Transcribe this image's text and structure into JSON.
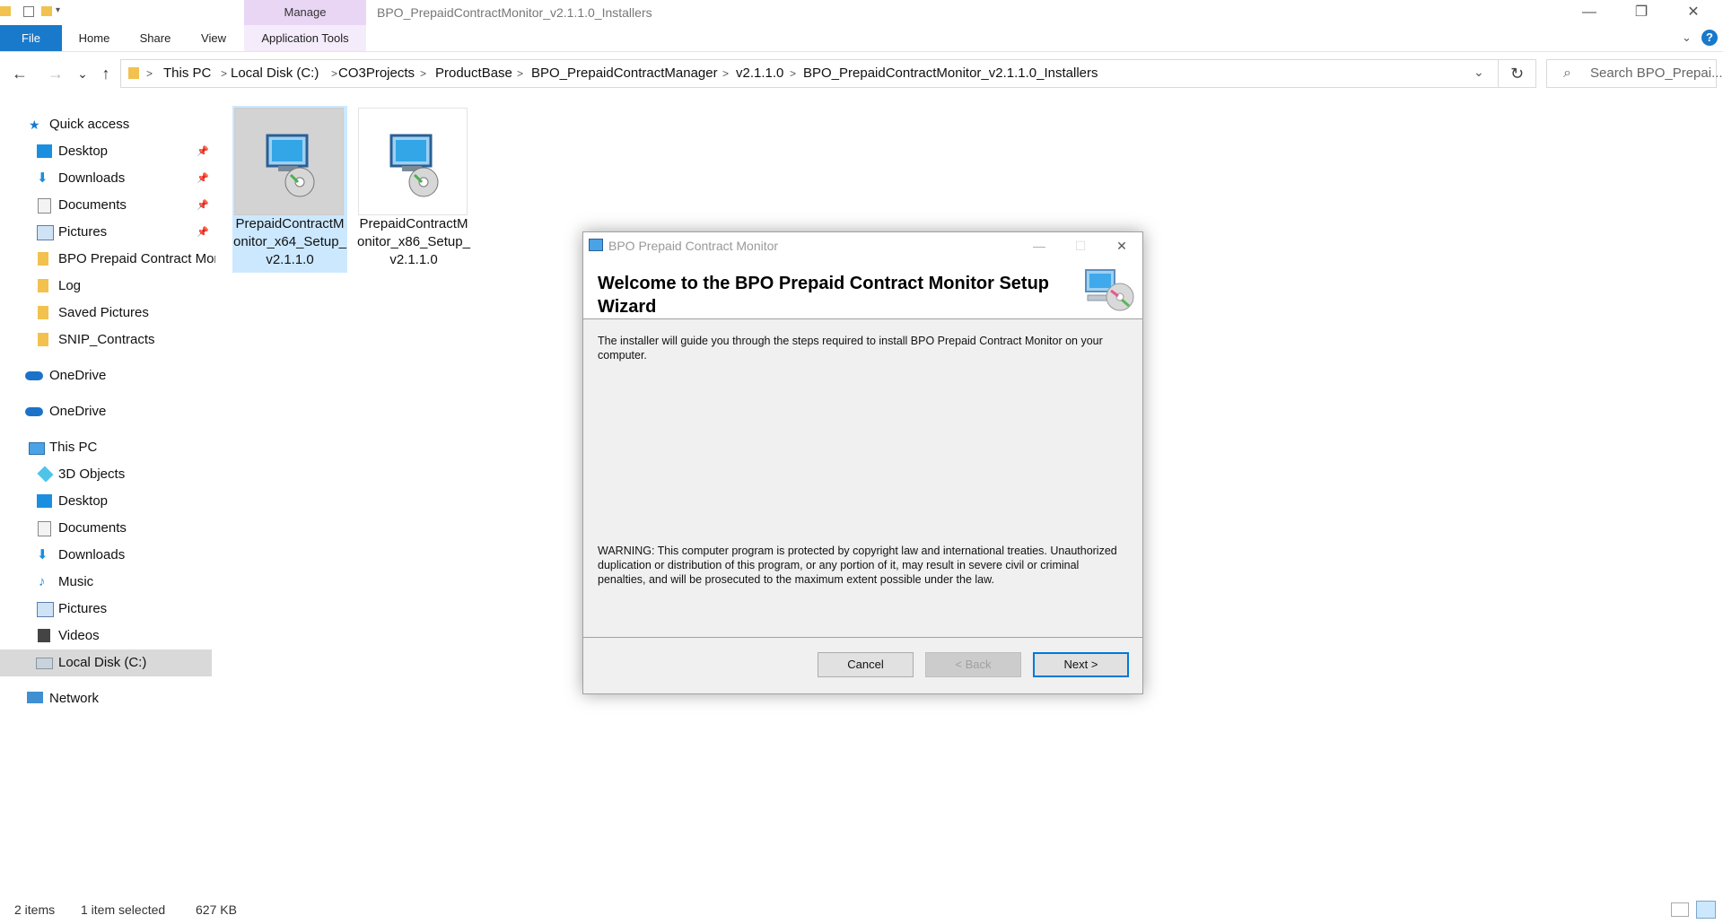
{
  "window": {
    "title": "BPO_PrepaidContractMonitor_v2.1.1.0_Installers",
    "context_tab": "Manage",
    "controls": {
      "minimize": "—",
      "restore": "❐",
      "close": "✕"
    }
  },
  "ribbon": {
    "tabs": [
      "File",
      "Home",
      "Share",
      "View"
    ],
    "context_tab": "Application Tools",
    "help": "?"
  },
  "address": {
    "back": "←",
    "forward": "→",
    "recent": "⌄",
    "up": "↑",
    "crumbs": [
      "This PC",
      "Local Disk (C:)",
      "CO3Projects",
      "ProductBase",
      "BPO_PrepaidContractManager",
      "v2.1.1.0",
      "BPO_PrepaidContractMonitor_v2.1.1.0_Installers"
    ],
    "separator": ">",
    "dropdown": "⌄",
    "refresh": "↻",
    "search_placeholder": "Search BPO_Prepai..."
  },
  "navpane": {
    "quick_access": "Quick access",
    "quick_items": [
      "Desktop",
      "Downloads",
      "Documents",
      "Pictures",
      "BPO Prepaid Contract Monitor",
      "Log",
      "Saved Pictures",
      "SNIP_Contracts"
    ],
    "pin": "📌",
    "onedrive_1": "OneDrive",
    "onedrive_2": "OneDrive",
    "this_pc": "This PC",
    "pc_items": [
      "3D Objects",
      "Desktop",
      "Documents",
      "Downloads",
      "Music",
      "Pictures",
      "Videos",
      "Local Disk (C:)"
    ],
    "network": "Network"
  },
  "files": [
    {
      "name": "PrepaidContractMonitor_x64_Setup_v2.1.1.0",
      "selected": true
    },
    {
      "name": "PrepaidContractMonitor_x86_Setup_v2.1.1.0",
      "selected": false
    }
  ],
  "status": {
    "count": "2 items",
    "selection": "1 item selected",
    "size": "627 KB"
  },
  "dialog": {
    "title": "BPO Prepaid Contract Monitor",
    "heading": "Welcome to the BPO Prepaid Contract Monitor Setup Wizard",
    "intro": "The installer will guide you through the steps required to install BPO Prepaid Contract Monitor on your computer.",
    "warning": "WARNING: This computer program is protected by copyright law and international treaties. Unauthorized duplication or distribution of this program, or any portion of it, may result in severe civil or criminal penalties, and will be prosecuted to the maximum extent possible under the law.",
    "buttons": {
      "cancel": "Cancel",
      "back": "< Back",
      "next": "Next >"
    },
    "controls": {
      "minimize": "—",
      "maximize": "☐",
      "close": "✕"
    }
  },
  "colors": {
    "accent": "#1979ca",
    "manage_tab": "#e9d6f5",
    "selection": "#cce8ff",
    "nav_selected": "#d9d9d9"
  }
}
